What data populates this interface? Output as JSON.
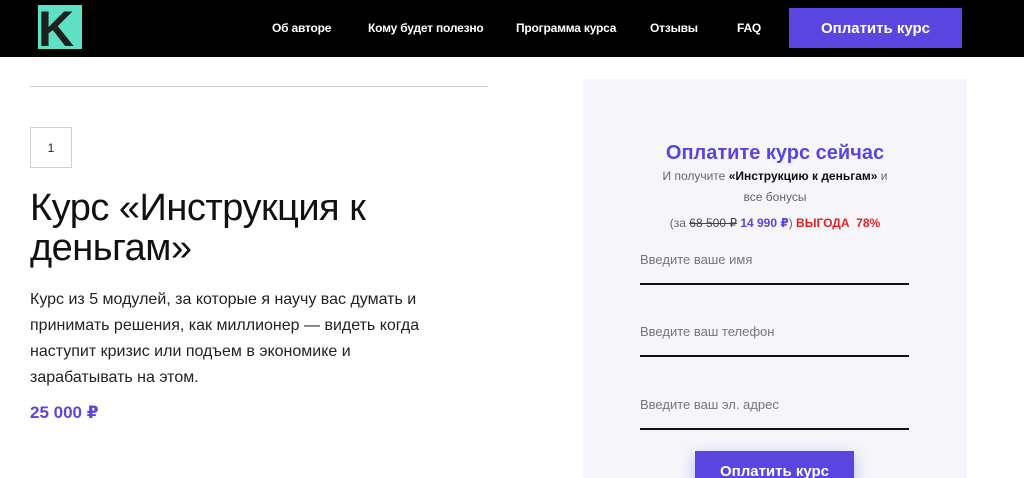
{
  "header": {
    "logo_letter": "K",
    "nav": [
      {
        "label": "Об авторе"
      },
      {
        "label": "Кому будет полезно"
      },
      {
        "label": "Программа курса"
      },
      {
        "label": "Отзывы"
      },
      {
        "label": "FAQ"
      }
    ],
    "pay_button": "Оплатить курс"
  },
  "product": {
    "quantity": "1",
    "title": "Курс «Инструкция к деньгам»",
    "description": "Курс из 5 модулей, за которые я научу вас думать и принимать решения, как миллионер — видеть когда наступит кризис или подъем в экономике и зарабатывать на этом.",
    "price": "25 000 ₽"
  },
  "order_card": {
    "title": "Оплатите курс сейчас",
    "subtitle_prefix": "И получите ",
    "subtitle_bold": "«Инструкцию к деньгам»",
    "subtitle_suffix": " и",
    "subtitle_line2": "все бонусы",
    "deal_prefix": "(за ",
    "old_price": "68 500 ₽",
    "new_price": "14 990 ₽",
    "deal_close": ")",
    "gain_label": "ВЫГОДА",
    "gain_percent": "78%",
    "fields": {
      "name_placeholder": "Введите ваше имя",
      "phone_placeholder": "Введите ваш телефон",
      "email_placeholder": "Введите ваш эл. адрес"
    },
    "submit_label": "Оплатить курс"
  },
  "colors": {
    "accent": "#5a45e0",
    "logo_bg": "#5de0c3",
    "topbar_bg": "#000000",
    "card_bg": "#f5f5fa",
    "gain_red": "#e02424"
  }
}
